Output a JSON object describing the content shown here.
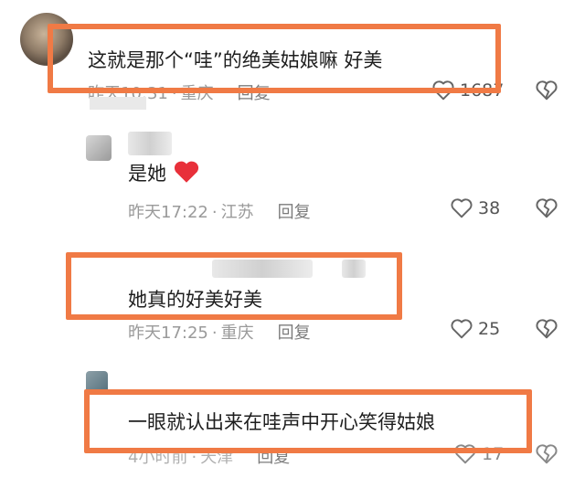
{
  "comments": [
    {
      "text": "这就是那个“哇”的绝美姑娘嘛 好美",
      "time": "昨天10:31",
      "location": "重庆",
      "reply_label": "回复",
      "likes": "1687"
    },
    {
      "text": "是她",
      "time": "昨天17:22",
      "location": "江苏",
      "reply_label": "回复",
      "likes": "38"
    },
    {
      "text": "她真的好美好美",
      "time": "昨天17:25",
      "location": "重庆",
      "reply_label": "回复",
      "likes": "25"
    },
    {
      "text": "一眼就认出来在哇声中开心笑得姑娘",
      "time": "4小时前",
      "location": "天津",
      "reply_label": "回复",
      "likes": "17"
    }
  ],
  "separator": "·",
  "colors": {
    "highlight_border": "#f07a45",
    "meta_text": "#9a9a9a",
    "emoji_heart": "#e8303a"
  },
  "icons": [
    "heart-outline-icon",
    "broken-heart-icon",
    "red-heart-emoji"
  ]
}
